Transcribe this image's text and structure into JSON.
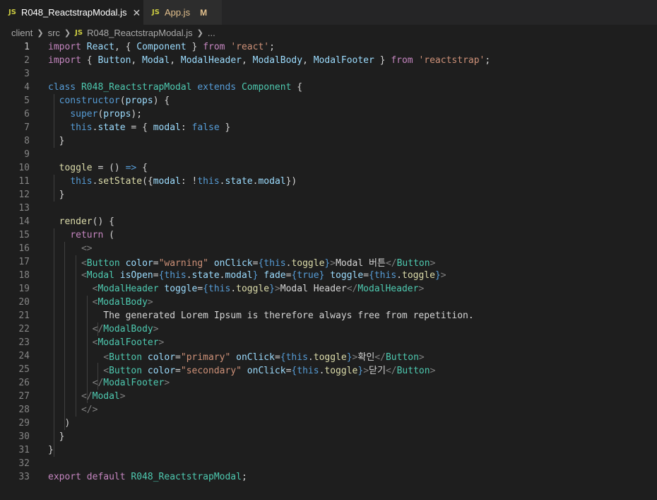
{
  "tabs": [
    {
      "label": "R048_ReactstrapModal.js",
      "icon": "JS",
      "close": "✕"
    },
    {
      "label": "App.js",
      "icon": "JS",
      "modified": "M"
    }
  ],
  "breadcrumb": {
    "parts": [
      "client",
      "src",
      "R048_ReactstrapModal.js",
      "..."
    ],
    "file_icon": "JS"
  },
  "editor": {
    "colors": {
      "keyword": "#569cd6",
      "control": "#c586c0",
      "string": "#ce9178",
      "variable": "#9cdcfe",
      "function": "#dcdcaa",
      "class": "#4ec9b0",
      "tag_bracket": "#808080",
      "text": "#d4d4d4"
    },
    "lines": [
      [
        [
          "import",
          "control"
        ],
        [
          " ",
          "text"
        ],
        [
          "React",
          "variable"
        ],
        [
          ", { ",
          "text"
        ],
        [
          "Component",
          "variable"
        ],
        [
          " } ",
          "text"
        ],
        [
          "from",
          "control"
        ],
        [
          " ",
          "text"
        ],
        [
          "'react'",
          "string"
        ],
        [
          ";",
          "text"
        ]
      ],
      [
        [
          "import",
          "control"
        ],
        [
          " { ",
          "text"
        ],
        [
          "Button",
          "variable"
        ],
        [
          ", ",
          "text"
        ],
        [
          "Modal",
          "variable"
        ],
        [
          ", ",
          "text"
        ],
        [
          "ModalHeader",
          "variable"
        ],
        [
          ", ",
          "text"
        ],
        [
          "ModalBody",
          "variable"
        ],
        [
          ", ",
          "text"
        ],
        [
          "ModalFooter",
          "variable"
        ],
        [
          " } ",
          "text"
        ],
        [
          "from",
          "control"
        ],
        [
          " ",
          "text"
        ],
        [
          "'reactstrap'",
          "string"
        ],
        [
          ";",
          "text"
        ]
      ],
      [],
      [
        [
          "class",
          "keyword"
        ],
        [
          " ",
          "text"
        ],
        [
          "R048_ReactstrapModal",
          "class"
        ],
        [
          " ",
          "text"
        ],
        [
          "extends",
          "keyword"
        ],
        [
          " ",
          "text"
        ],
        [
          "Component",
          "class"
        ],
        [
          " {",
          "text"
        ]
      ],
      [
        [
          "  ",
          "text"
        ],
        [
          "constructor",
          "keyword"
        ],
        [
          "(",
          "text"
        ],
        [
          "props",
          "variable"
        ],
        [
          ") {",
          "text"
        ]
      ],
      [
        [
          "    ",
          "text"
        ],
        [
          "super",
          "keyword"
        ],
        [
          "(",
          "text"
        ],
        [
          "props",
          "variable"
        ],
        [
          ");",
          "text"
        ]
      ],
      [
        [
          "    ",
          "text"
        ],
        [
          "this",
          "keyword"
        ],
        [
          ".",
          "text"
        ],
        [
          "state",
          "variable"
        ],
        [
          " = { ",
          "text"
        ],
        [
          "modal",
          "variable"
        ],
        [
          ": ",
          "text"
        ],
        [
          "false",
          "keyword"
        ],
        [
          " }",
          "text"
        ]
      ],
      [
        [
          "  }",
          "text"
        ]
      ],
      [],
      [
        [
          "  ",
          "text"
        ],
        [
          "toggle",
          "function"
        ],
        [
          " = () ",
          "text"
        ],
        [
          "=>",
          "keyword"
        ],
        [
          " {",
          "text"
        ]
      ],
      [
        [
          "    ",
          "text"
        ],
        [
          "this",
          "keyword"
        ],
        [
          ".",
          "text"
        ],
        [
          "setState",
          "function"
        ],
        [
          "({",
          "text"
        ],
        [
          "modal",
          "variable"
        ],
        [
          ": !",
          "text"
        ],
        [
          "this",
          "keyword"
        ],
        [
          ".",
          "text"
        ],
        [
          "state",
          "variable"
        ],
        [
          ".",
          "text"
        ],
        [
          "modal",
          "variable"
        ],
        [
          "})",
          "text"
        ]
      ],
      [
        [
          "  }",
          "text"
        ]
      ],
      [],
      [
        [
          "  ",
          "text"
        ],
        [
          "render",
          "function"
        ],
        [
          "() {",
          "text"
        ]
      ],
      [
        [
          "    ",
          "text"
        ],
        [
          "return",
          "control"
        ],
        [
          " (",
          "text"
        ]
      ],
      [
        [
          "      ",
          "text"
        ],
        [
          "<>",
          "tag_bracket"
        ]
      ],
      [
        [
          "      ",
          "text"
        ],
        [
          "<",
          "tag_bracket"
        ],
        [
          "Button",
          "class"
        ],
        [
          " ",
          "text"
        ],
        [
          "color",
          "variable"
        ],
        [
          "=",
          "text"
        ],
        [
          "\"warning\"",
          "string"
        ],
        [
          " ",
          "text"
        ],
        [
          "onClick",
          "variable"
        ],
        [
          "=",
          "text"
        ],
        [
          "{",
          "keyword"
        ],
        [
          "this",
          "keyword"
        ],
        [
          ".",
          "text"
        ],
        [
          "toggle",
          "function"
        ],
        [
          "}",
          "keyword"
        ],
        [
          ">",
          "tag_bracket"
        ],
        [
          "Modal 버튼",
          "text"
        ],
        [
          "</",
          "tag_bracket"
        ],
        [
          "Button",
          "class"
        ],
        [
          ">",
          "tag_bracket"
        ]
      ],
      [
        [
          "      ",
          "text"
        ],
        [
          "<",
          "tag_bracket"
        ],
        [
          "Modal",
          "class"
        ],
        [
          " ",
          "text"
        ],
        [
          "isOpen",
          "variable"
        ],
        [
          "=",
          "text"
        ],
        [
          "{",
          "keyword"
        ],
        [
          "this",
          "keyword"
        ],
        [
          ".",
          "text"
        ],
        [
          "state",
          "variable"
        ],
        [
          ".",
          "text"
        ],
        [
          "modal",
          "variable"
        ],
        [
          "}",
          "keyword"
        ],
        [
          " ",
          "text"
        ],
        [
          "fade",
          "variable"
        ],
        [
          "=",
          "text"
        ],
        [
          "{",
          "keyword"
        ],
        [
          "true",
          "keyword"
        ],
        [
          "}",
          "keyword"
        ],
        [
          " ",
          "text"
        ],
        [
          "toggle",
          "variable"
        ],
        [
          "=",
          "text"
        ],
        [
          "{",
          "keyword"
        ],
        [
          "this",
          "keyword"
        ],
        [
          ".",
          "text"
        ],
        [
          "toggle",
          "function"
        ],
        [
          "}",
          "keyword"
        ],
        [
          ">",
          "tag_bracket"
        ]
      ],
      [
        [
          "        ",
          "text"
        ],
        [
          "<",
          "tag_bracket"
        ],
        [
          "ModalHeader",
          "class"
        ],
        [
          " ",
          "text"
        ],
        [
          "toggle",
          "variable"
        ],
        [
          "=",
          "text"
        ],
        [
          "{",
          "keyword"
        ],
        [
          "this",
          "keyword"
        ],
        [
          ".",
          "text"
        ],
        [
          "toggle",
          "function"
        ],
        [
          "}",
          "keyword"
        ],
        [
          ">",
          "tag_bracket"
        ],
        [
          "Modal Header",
          "text"
        ],
        [
          "</",
          "tag_bracket"
        ],
        [
          "ModalHeader",
          "class"
        ],
        [
          ">",
          "tag_bracket"
        ]
      ],
      [
        [
          "        ",
          "text"
        ],
        [
          "<",
          "tag_bracket"
        ],
        [
          "ModalBody",
          "class"
        ],
        [
          ">",
          "tag_bracket"
        ]
      ],
      [
        [
          "          ",
          "text"
        ],
        [
          "The generated Lorem Ipsum is therefore always free from repetition.",
          "text"
        ]
      ],
      [
        [
          "        ",
          "text"
        ],
        [
          "</",
          "tag_bracket"
        ],
        [
          "ModalBody",
          "class"
        ],
        [
          ">",
          "tag_bracket"
        ]
      ],
      [
        [
          "        ",
          "text"
        ],
        [
          "<",
          "tag_bracket"
        ],
        [
          "ModalFooter",
          "class"
        ],
        [
          ">",
          "tag_bracket"
        ]
      ],
      [
        [
          "          ",
          "text"
        ],
        [
          "<",
          "tag_bracket"
        ],
        [
          "Button",
          "class"
        ],
        [
          " ",
          "text"
        ],
        [
          "color",
          "variable"
        ],
        [
          "=",
          "text"
        ],
        [
          "\"primary\"",
          "string"
        ],
        [
          " ",
          "text"
        ],
        [
          "onClick",
          "variable"
        ],
        [
          "=",
          "text"
        ],
        [
          "{",
          "keyword"
        ],
        [
          "this",
          "keyword"
        ],
        [
          ".",
          "text"
        ],
        [
          "toggle",
          "function"
        ],
        [
          "}",
          "keyword"
        ],
        [
          ">",
          "tag_bracket"
        ],
        [
          "확인",
          "text"
        ],
        [
          "</",
          "tag_bracket"
        ],
        [
          "Button",
          "class"
        ],
        [
          ">",
          "tag_bracket"
        ]
      ],
      [
        [
          "          ",
          "text"
        ],
        [
          "<",
          "tag_bracket"
        ],
        [
          "Button",
          "class"
        ],
        [
          " ",
          "text"
        ],
        [
          "color",
          "variable"
        ],
        [
          "=",
          "text"
        ],
        [
          "\"secondary\"",
          "string"
        ],
        [
          " ",
          "text"
        ],
        [
          "onClick",
          "variable"
        ],
        [
          "=",
          "text"
        ],
        [
          "{",
          "keyword"
        ],
        [
          "this",
          "keyword"
        ],
        [
          ".",
          "text"
        ],
        [
          "toggle",
          "function"
        ],
        [
          "}",
          "keyword"
        ],
        [
          ">",
          "tag_bracket"
        ],
        [
          "닫기",
          "text"
        ],
        [
          "</",
          "tag_bracket"
        ],
        [
          "Button",
          "class"
        ],
        [
          ">",
          "tag_bracket"
        ]
      ],
      [
        [
          "        ",
          "text"
        ],
        [
          "</",
          "tag_bracket"
        ],
        [
          "ModalFooter",
          "class"
        ],
        [
          ">",
          "tag_bracket"
        ]
      ],
      [
        [
          "      ",
          "text"
        ],
        [
          "</",
          "tag_bracket"
        ],
        [
          "Modal",
          "class"
        ],
        [
          ">",
          "tag_bracket"
        ]
      ],
      [
        [
          "      ",
          "text"
        ],
        [
          "</>",
          "tag_bracket"
        ]
      ],
      [
        [
          "   )",
          "text"
        ]
      ],
      [
        [
          "  }",
          "text"
        ]
      ],
      [
        [
          "}",
          "text"
        ]
      ],
      [],
      [
        [
          "export",
          "control"
        ],
        [
          " ",
          "text"
        ],
        [
          "default",
          "control"
        ],
        [
          " ",
          "text"
        ],
        [
          "R048_ReactstrapModal",
          "class"
        ],
        [
          ";",
          "text"
        ]
      ]
    ]
  }
}
